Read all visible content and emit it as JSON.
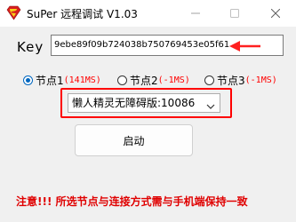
{
  "window": {
    "title": "SuPer 远程调试 V1.03",
    "app_icon": "superman-logo-icon",
    "controls": {
      "minimize_icon": "minimize-icon",
      "maximize_icon": "maximize-icon",
      "close_icon": "close-icon"
    }
  },
  "key": {
    "label": "Key",
    "value": "9ebe89f09b724038b750769453e05f61",
    "annotation_icon": "red-arrow-icon"
  },
  "nodes": [
    {
      "name": "节点1",
      "ping": "(141MS)",
      "checked": true
    },
    {
      "name": "节点2",
      "ping": "(-1MS)",
      "checked": false
    },
    {
      "name": "节点3",
      "ping": "(-1MS)",
      "checked": false
    }
  ],
  "connection_select": {
    "selected": "懒人精灵无障碍版:10086",
    "chevron_icon": "chevron-down-icon"
  },
  "start_button": {
    "label": "启动"
  },
  "warning": {
    "text": "注意!!! 所选节点与连接方式需与手机端保持一致"
  },
  "colors": {
    "accent": "#0067c0",
    "warning_red": "#e00000",
    "highlight_border": "#ff0000",
    "ping_red": "#ff0000"
  }
}
